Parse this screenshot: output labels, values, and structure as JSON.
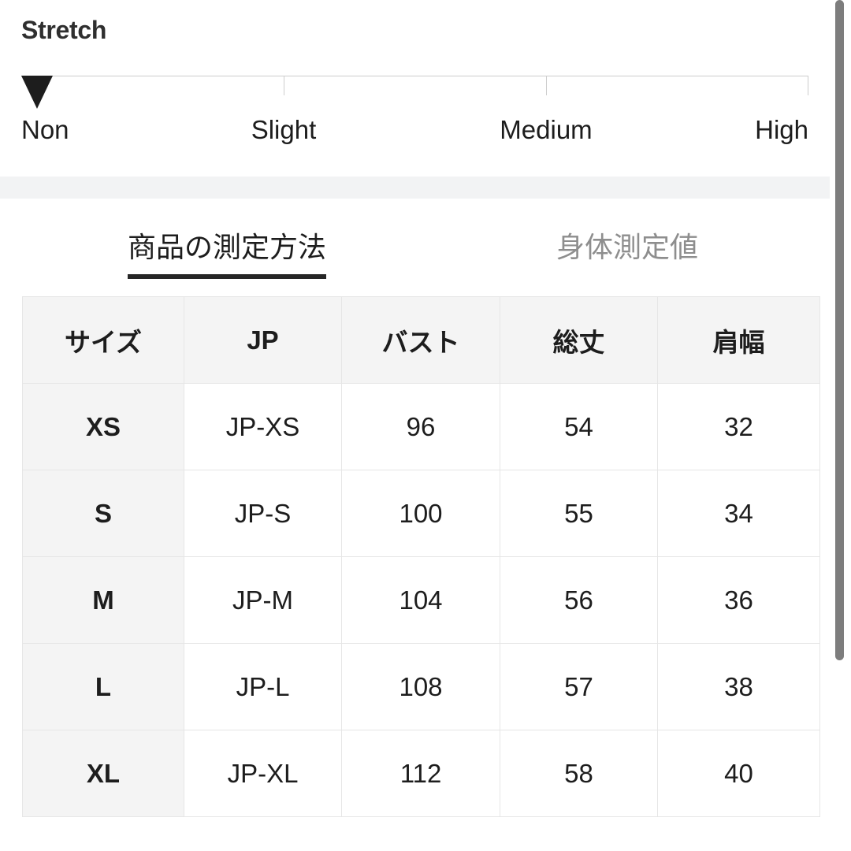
{
  "clipped_header": {
    "text": "サイズ"
  },
  "stretch": {
    "heading": "Stretch",
    "scale_labels": [
      "Non",
      "Slight",
      "Medium",
      "High"
    ],
    "selected_label": "Non",
    "marker_position_index": 0,
    "marker_icon": "down-triangle-icon"
  },
  "tabs": [
    {
      "label": "商品の測定方法",
      "active": true
    },
    {
      "label": "身体測定値",
      "active": false
    }
  ],
  "size_table": {
    "columns": [
      "サイズ",
      "JP",
      "バスト",
      "総丈",
      "肩幅"
    ],
    "rows": [
      {
        "size": "XS",
        "jp": "JP-XS",
        "bust": "96",
        "length": "54",
        "shoulder": "32"
      },
      {
        "size": "S",
        "jp": "JP-S",
        "bust": "100",
        "length": "55",
        "shoulder": "34"
      },
      {
        "size": "M",
        "jp": "JP-M",
        "bust": "104",
        "length": "56",
        "shoulder": "36"
      },
      {
        "size": "L",
        "jp": "JP-L",
        "bust": "108",
        "length": "57",
        "shoulder": "38"
      },
      {
        "size": "XL",
        "jp": "JP-XL",
        "bust": "112",
        "length": "58",
        "shoulder": "40"
      }
    ]
  },
  "scrollbar": {
    "name": "vertical-scrollbar"
  },
  "colors": {
    "text_primary": "#1d1d1d",
    "text_muted": "#8e8e8e",
    "table_header_bg": "#f4f4f4",
    "table_border": "#e6e6e6",
    "divider_band": "#f2f3f4",
    "scrollbar_thumb": "#7d7d7d",
    "marker": "#1d1d1d"
  }
}
